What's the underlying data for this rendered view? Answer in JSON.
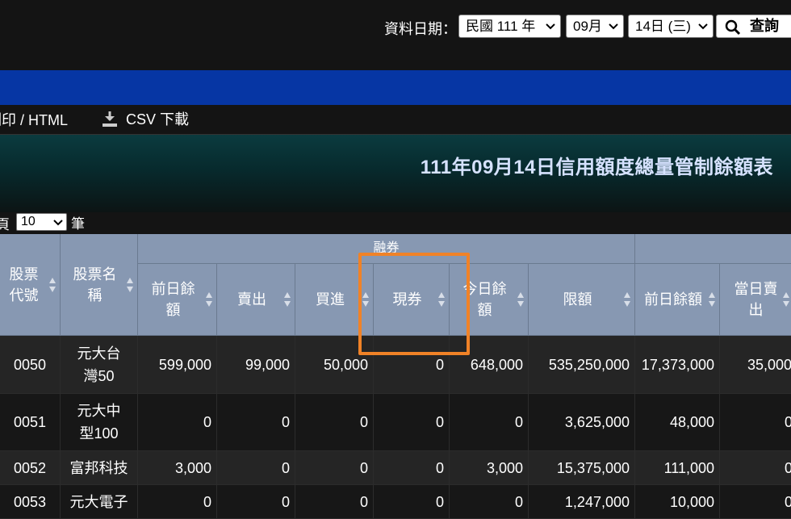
{
  "header": {
    "date_label": "資料日期：",
    "year_select": "民國 111 年",
    "month_select": "09月",
    "day_select": "14日 (三)",
    "query_button": "查詢"
  },
  "toolbar": {
    "print_label": "列印 / HTML",
    "csv_label": "CSV 下載"
  },
  "report_title": "111年09月14日信用額度總量管制餘額表",
  "page_size": {
    "prefix": "頁",
    "value": "10",
    "suffix": "筆"
  },
  "table": {
    "group_header": "融券",
    "headers": {
      "code": "股票代號",
      "name": "股票名稱",
      "prev_balance": "前日餘額",
      "sell": "賣出",
      "buy": "買進",
      "spot": "現券",
      "today_balance": "今日餘額",
      "limit": "限額",
      "prev_balance2": "前日餘額",
      "day_sell": "當日賣出"
    },
    "rows": [
      {
        "code": "0050",
        "name": "元大台灣50",
        "prev": "599,000",
        "sell": "99,000",
        "buy": "50,000",
        "spot": "0",
        "today": "648,000",
        "limit": "535,250,000",
        "prev2": "17,373,000",
        "daysell": "35,000"
      },
      {
        "code": "0051",
        "name": "元大中型100",
        "prev": "0",
        "sell": "0",
        "buy": "0",
        "spot": "0",
        "today": "0",
        "limit": "3,625,000",
        "prev2": "48,000",
        "daysell": "0"
      },
      {
        "code": "0052",
        "name": "富邦科技",
        "prev": "3,000",
        "sell": "0",
        "buy": "0",
        "spot": "0",
        "today": "3,000",
        "limit": "15,375,000",
        "prev2": "111,000",
        "daysell": "0"
      },
      {
        "code": "0053",
        "name": "元大電子",
        "prev": "0",
        "sell": "0",
        "buy": "0",
        "spot": "0",
        "today": "0",
        "limit": "1,247,000",
        "prev2": "10,000",
        "daysell": "0"
      }
    ]
  },
  "colors": {
    "header_bg": "#8798b2",
    "blue_bar": "#0636a4",
    "highlight": "#f08227"
  }
}
